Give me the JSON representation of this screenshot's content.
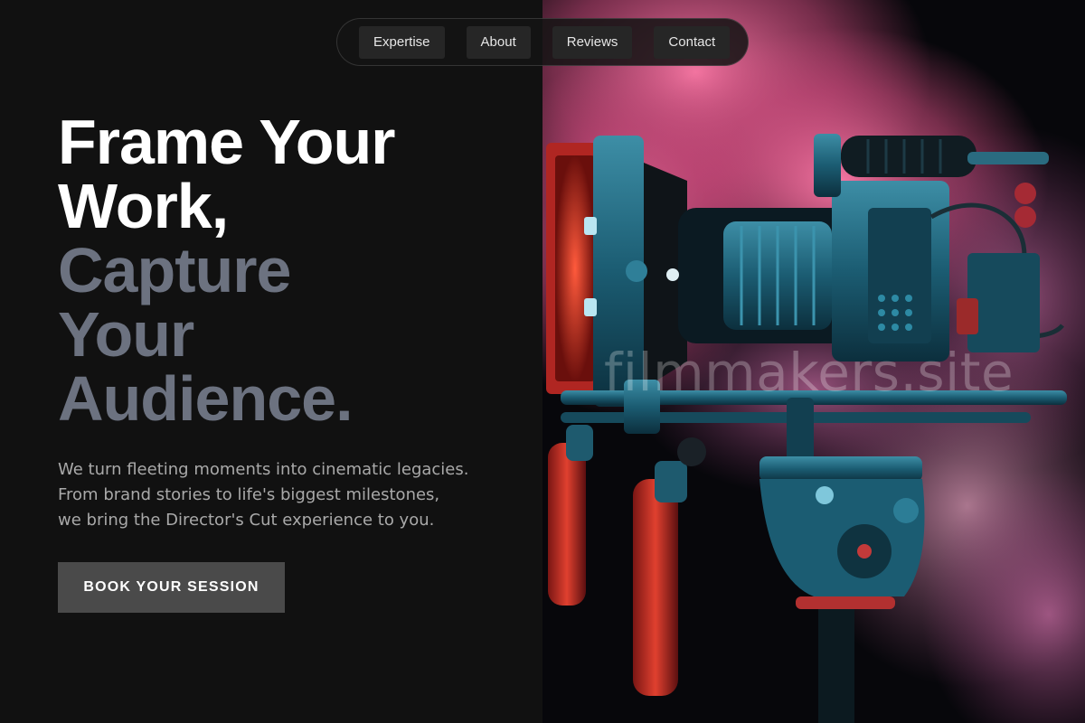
{
  "nav": {
    "items": [
      {
        "label": "Expertise"
      },
      {
        "label": "About"
      },
      {
        "label": "Reviews"
      },
      {
        "label": "Contact"
      }
    ]
  },
  "hero": {
    "headline_lines": [
      "Frame Your",
      "Work,",
      "Capture",
      "Your",
      "Audience."
    ],
    "subtitle_lines": [
      "We turn fleeting moments into cinematic legacies.",
      "From brand stories to life's biggest milestones,",
      "we bring the Director's Cut experience to you."
    ],
    "cta_label": "BOOK YOUR SESSION"
  },
  "image": {
    "watermark": "filmmakers.site",
    "subject": "cinema camera rig in pink smoke"
  },
  "colors": {
    "background": "#111111",
    "headline_white": "#ffffff",
    "headline_grey": "#6c7280",
    "cta_bg": "#4a4a4a",
    "smoke_pink": "#e8628f",
    "rig_teal": "#1f6f86",
    "rig_red": "#d2322c"
  }
}
